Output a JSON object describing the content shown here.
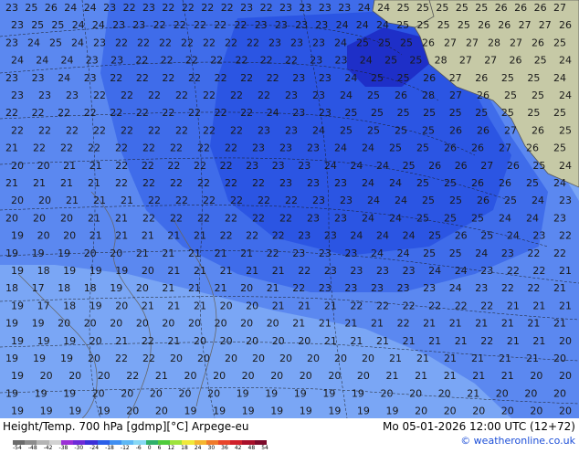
{
  "map": {
    "colors": {
      "land": "#c6c9a6",
      "sea_temp_outer": "#7aa6f5",
      "sea_temp_mid": "#5b88f0",
      "sea_temp_inner": "#3f6cea",
      "sea_temp_core": "#2b55e3",
      "cold_core": "#1e2fc8",
      "contour": "#1a1a1a",
      "coast": "#666666"
    },
    "rows": [
      {
        "labels": [
          "23",
          "25",
          "26",
          "24",
          "24",
          "23",
          "22",
          "23",
          "22",
          "22",
          "22",
          "22",
          "23",
          "22",
          "23",
          "23",
          "23",
          "23",
          "24",
          "24",
          "25",
          "25",
          "25",
          "25",
          "25",
          "26",
          "26",
          "26",
          "27"
        ]
      },
      {
        "labels": [
          "23",
          "25",
          "25",
          "24",
          "24",
          "23",
          "23",
          "22",
          "22",
          "22",
          "22",
          "22",
          "23",
          "23",
          "23",
          "23",
          "24",
          "24",
          "24",
          "25",
          "25",
          "25",
          "25",
          "26",
          "26",
          "27",
          "27",
          "26"
        ]
      },
      {
        "labels": [
          "23",
          "24",
          "25",
          "24",
          "23",
          "22",
          "22",
          "22",
          "22",
          "22",
          "22",
          "22",
          "23",
          "23",
          "23",
          "24",
          "25",
          "25",
          "25",
          "26",
          "27",
          "27",
          "28",
          "27",
          "26",
          "25"
        ]
      },
      {
        "labels": [
          "24",
          "24",
          "24",
          "23",
          "23",
          "22",
          "22",
          "22",
          "22",
          "22",
          "22",
          "22",
          "23",
          "23",
          "24",
          "25",
          "25",
          "28",
          "27",
          "27",
          "26",
          "25",
          "24"
        ]
      },
      {
        "labels": [
          "23",
          "23",
          "24",
          "23",
          "22",
          "22",
          "22",
          "22",
          "22",
          "22",
          "22",
          "23",
          "23",
          "24",
          "25",
          "25",
          "26",
          "27",
          "26",
          "25",
          "25",
          "24"
        ]
      },
      {
        "labels": [
          "23",
          "23",
          "23",
          "22",
          "22",
          "22",
          "22",
          "22",
          "22",
          "22",
          "23",
          "23",
          "24",
          "25",
          "26",
          "28",
          "27",
          "26",
          "25",
          "25",
          "24"
        ]
      },
      {
        "labels": [
          "22",
          "22",
          "22",
          "22",
          "22",
          "22",
          "22",
          "22",
          "22",
          "22",
          "24",
          "23",
          "23",
          "25",
          "25",
          "25",
          "25",
          "25",
          "25",
          "25",
          "25",
          "25"
        ]
      },
      {
        "labels": [
          "22",
          "22",
          "22",
          "22",
          "22",
          "22",
          "22",
          "22",
          "22",
          "23",
          "23",
          "24",
          "25",
          "25",
          "25",
          "25",
          "26",
          "26",
          "27",
          "26",
          "25"
        ]
      },
      {
        "labels": [
          "21",
          "22",
          "22",
          "22",
          "22",
          "22",
          "22",
          "22",
          "22",
          "23",
          "23",
          "23",
          "24",
          "24",
          "25",
          "25",
          "26",
          "26",
          "27",
          "26",
          "25"
        ]
      },
      {
        "labels": [
          "20",
          "20",
          "21",
          "21",
          "22",
          "22",
          "22",
          "22",
          "22",
          "23",
          "23",
          "23",
          "24",
          "24",
          "24",
          "25",
          "26",
          "26",
          "27",
          "26",
          "25",
          "24"
        ]
      },
      {
        "labels": [
          "21",
          "21",
          "21",
          "21",
          "22",
          "22",
          "22",
          "22",
          "22",
          "22",
          "23",
          "23",
          "23",
          "24",
          "24",
          "25",
          "25",
          "26",
          "26",
          "25",
          "24"
        ]
      },
      {
        "labels": [
          "20",
          "20",
          "21",
          "21",
          "21",
          "22",
          "22",
          "22",
          "22",
          "22",
          "22",
          "23",
          "23",
          "24",
          "24",
          "25",
          "25",
          "26",
          "25",
          "24",
          "23"
        ]
      },
      {
        "labels": [
          "20",
          "20",
          "20",
          "21",
          "21",
          "22",
          "22",
          "22",
          "22",
          "22",
          "22",
          "23",
          "23",
          "24",
          "24",
          "25",
          "25",
          "25",
          "24",
          "24",
          "23"
        ]
      },
      {
        "labels": [
          "19",
          "20",
          "20",
          "21",
          "21",
          "21",
          "21",
          "21",
          "22",
          "22",
          "22",
          "23",
          "23",
          "24",
          "24",
          "24",
          "25",
          "26",
          "25",
          "24",
          "23",
          "22"
        ]
      },
      {
        "labels": [
          "19",
          "19",
          "19",
          "20",
          "20",
          "21",
          "21",
          "21",
          "21",
          "21",
          "22",
          "23",
          "23",
          "23",
          "24",
          "24",
          "25",
          "25",
          "24",
          "23",
          "22",
          "22"
        ]
      },
      {
        "labels": [
          "19",
          "18",
          "19",
          "19",
          "19",
          "20",
          "21",
          "21",
          "21",
          "21",
          "21",
          "22",
          "23",
          "23",
          "23",
          "23",
          "24",
          "24",
          "23",
          "22",
          "22",
          "21"
        ]
      },
      {
        "labels": [
          "18",
          "17",
          "18",
          "18",
          "19",
          "20",
          "21",
          "21",
          "21",
          "20",
          "21",
          "22",
          "23",
          "23",
          "23",
          "23",
          "23",
          "24",
          "23",
          "22",
          "22",
          "21"
        ]
      },
      {
        "labels": [
          "19",
          "17",
          "18",
          "19",
          "20",
          "21",
          "21",
          "21",
          "20",
          "20",
          "21",
          "21",
          "21",
          "22",
          "22",
          "22",
          "22",
          "22",
          "22",
          "21",
          "21",
          "21"
        ]
      },
      {
        "labels": [
          "19",
          "19",
          "20",
          "20",
          "20",
          "20",
          "20",
          "20",
          "20",
          "20",
          "20",
          "21",
          "21",
          "21",
          "21",
          "22",
          "21",
          "21",
          "21",
          "21",
          "21",
          "21"
        ]
      },
      {
        "labels": [
          "19",
          "19",
          "19",
          "20",
          "21",
          "22",
          "21",
          "20",
          "20",
          "20",
          "20",
          "20",
          "21",
          "21",
          "21",
          "21",
          "21",
          "21",
          "22",
          "21",
          "21",
          "20"
        ]
      },
      {
        "labels": [
          "19",
          "19",
          "19",
          "20",
          "22",
          "22",
          "20",
          "20",
          "20",
          "20",
          "20",
          "20",
          "20",
          "20",
          "21",
          "21",
          "21",
          "21",
          "21",
          "21",
          "20"
        ]
      },
      {
        "labels": [
          "19",
          "20",
          "20",
          "20",
          "22",
          "21",
          "20",
          "20",
          "20",
          "20",
          "20",
          "20",
          "20",
          "21",
          "21",
          "21",
          "21",
          "21",
          "20",
          "20"
        ]
      },
      {
        "labels": [
          "19",
          "19",
          "19",
          "20",
          "20",
          "20",
          "20",
          "20",
          "19",
          "19",
          "19",
          "19",
          "19",
          "20",
          "20",
          "20",
          "21",
          "20",
          "20",
          "20"
        ]
      },
      {
        "labels": [
          "19",
          "19",
          "19",
          "19",
          "20",
          "20",
          "19",
          "19",
          "19",
          "19",
          "19",
          "19",
          "19",
          "19",
          "20",
          "20",
          "20",
          "20",
          "20",
          "20"
        ]
      }
    ]
  },
  "footer": {
    "title": "Height/Temp. 700 hPa [gdmp][°C] Arpege-eu",
    "valid": "Mo 05-01-2026 12:00 UTC (12+72)",
    "credit": "© weatheronline.co.uk",
    "colorbar": {
      "colors": [
        "#6b6b6b",
        "#8c8c8c",
        "#b4b4b4",
        "#d2d2d2",
        "#9b2fd6",
        "#6e2bd8",
        "#3b2fd8",
        "#2a5ee8",
        "#3f8ff2",
        "#5fb8f5",
        "#88d8f5",
        "#2fb06a",
        "#4fcb3c",
        "#9ee33c",
        "#f0e93a",
        "#f5b62f",
        "#f07a2a",
        "#e8452a",
        "#d0202a",
        "#a8102a",
        "#7a0a2a"
      ],
      "ticks": [
        "-54",
        "-48",
        "-42",
        "-38",
        "-30",
        "-24",
        "-18",
        "-12",
        "-6",
        "0",
        "6",
        "12",
        "18",
        "24",
        "30",
        "36",
        "42",
        "48",
        "54"
      ]
    }
  }
}
